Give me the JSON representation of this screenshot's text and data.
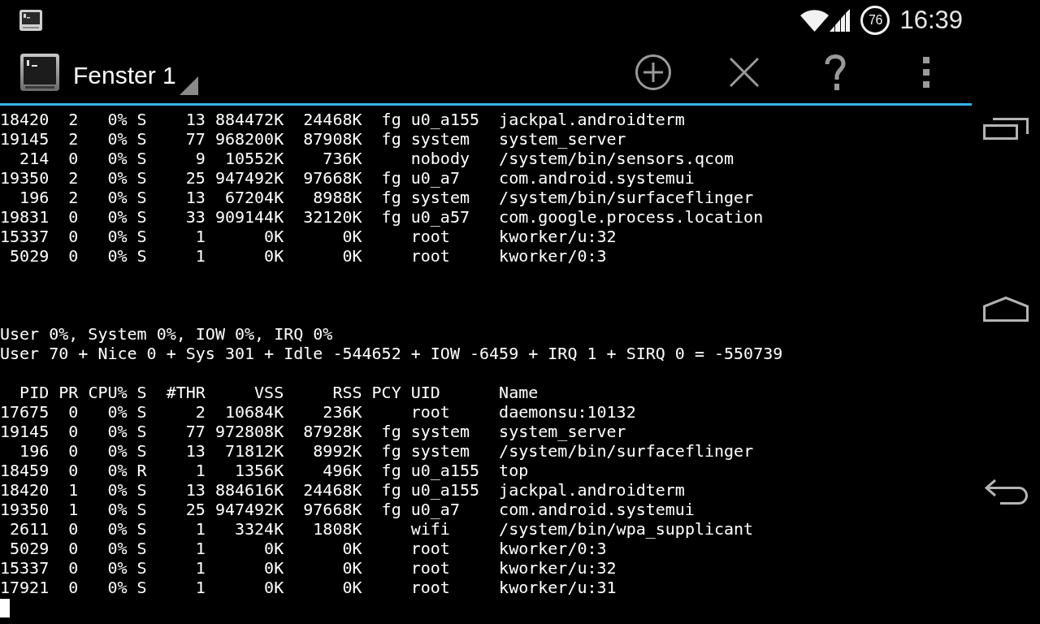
{
  "status_bar": {
    "battery_percent": "76",
    "time": "16:39"
  },
  "action_bar": {
    "title": "Fenster 1"
  },
  "terminal": {
    "earlier_rows": [
      "18420  2   0% S    13 884472K  24468K  fg u0_a155  jackpal.androidterm",
      "19145  2   0% S    77 968200K  87908K  fg system   system_server",
      "  214  0   0% S     9  10552K    736K     nobody   /system/bin/sensors.qcom",
      "19350  2   0% S    25 947492K  97668K  fg u0_a7    com.android.systemui",
      "  196  2   0% S    13  67204K   8988K  fg system   /system/bin/surfaceflinger",
      "19831  0   0% S    33 909144K  32120K  fg u0_a57   com.google.process.location",
      "15337  0   0% S     1      0K      0K     root     kworker/u:32",
      " 5029  0   0% S     1      0K      0K     root     kworker/0:3"
    ],
    "summary_lines": [
      "User 0%, System 0%, IOW 0%, IRQ 0%",
      "User 70 + Nice 0 + Sys 301 + Idle -544652 + IOW -6459 + IRQ 1 + SIRQ 0 = -550739"
    ],
    "header": "  PID PR CPU% S  #THR     VSS     RSS PCY UID      Name",
    "rows": [
      "17675  0   0% S     2  10684K    236K     root     daemonsu:10132",
      "19145  0   0% S    77 972808K  87928K  fg system   system_server",
      "  196  0   0% S    13  71812K   8992K  fg system   /system/bin/surfaceflinger",
      "18459  0   0% R     1   1356K    496K  fg u0_a155  top",
      "18420  1   0% S    13 884616K  24468K  fg u0_a155  jackpal.androidterm",
      "19350  1   0% S    25 947492K  97668K  fg u0_a7    com.android.systemui",
      " 2611  0   0% S     1   3324K   1808K     wifi     /system/bin/wpa_supplicant",
      " 5029  0   0% S     1      0K      0K     root     kworker/0:3",
      "15337  0   0% S     1      0K      0K     root     kworker/u:32",
      "17921  0   0% S     1      0K      0K     root     kworker/u:31"
    ]
  }
}
